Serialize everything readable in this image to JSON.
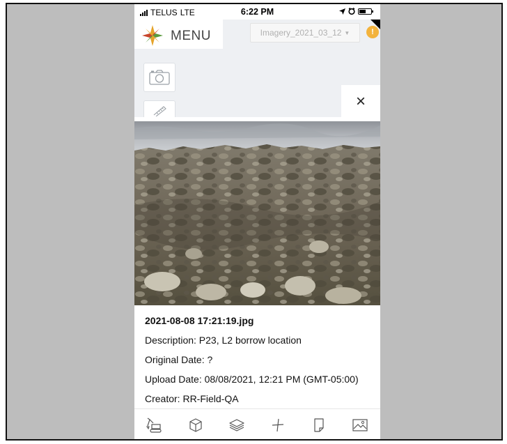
{
  "status_bar": {
    "carrier": "TELUS",
    "network": "LTE",
    "time": "6:22 PM"
  },
  "header": {
    "menu_label": "MENU",
    "imagery_select_value": "Imagery_2021_03_12",
    "info_badge": "!"
  },
  "tools": {
    "camera_icon": "camera-icon",
    "ruler_icon": "ruler-icon"
  },
  "close_icon": "×",
  "photo_panel": {
    "filename": "2021-08-08 17:21:19.jpg",
    "description": "Description: P23, L2 borrow location",
    "original_date": "Original Date: ?",
    "upload_date": "Upload Date: 08/08/2021, 12:21 PM (GMT-05:00)",
    "creator": "Creator: RR-Field-QA"
  },
  "bottom_nav": [
    {
      "icon": "excavator-icon"
    },
    {
      "icon": "cube-icon"
    },
    {
      "icon": "layers-icon"
    },
    {
      "icon": "crosshair-icon"
    },
    {
      "icon": "document-icon"
    },
    {
      "icon": "image-icon"
    }
  ],
  "colors": {
    "accent_orange": "#f3b33d",
    "background": "#eef0f3"
  }
}
